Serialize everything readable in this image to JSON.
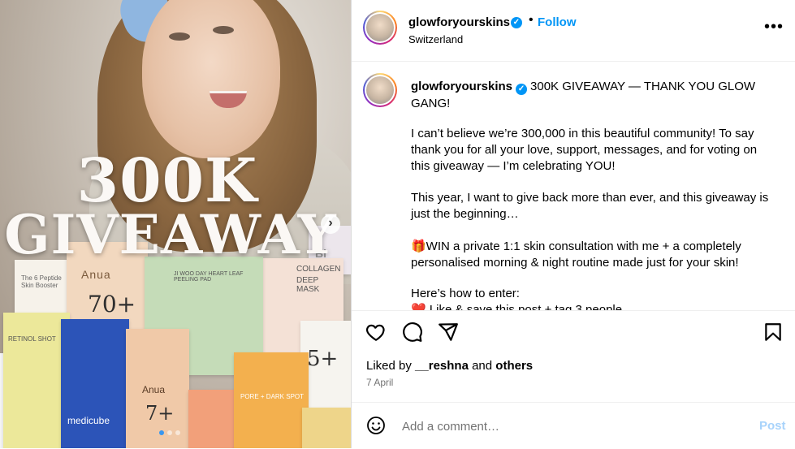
{
  "media": {
    "headline_line1": "300K",
    "headline_line2": "GIVEAWAY",
    "packaging": {
      "anua_big_brand": "Anua",
      "anua_big_number": "70+",
      "peptide_label": "The 6 Peptide Skin Booster",
      "green_box_label": "JI WOO DAY HEART LEAF PEELING PAD",
      "collagen_line1": "COLLAGEN",
      "collagen_line2": "DEEP MASK",
      "collagen_right_label": "Bi",
      "retinol_label": "RETINOL SHOT",
      "medicube_label": "medicube",
      "anua_small_brand": "Anua",
      "anua_small_number": "7+",
      "pore_label": "PORE + DARK SPOT",
      "mint_number": "5+"
    },
    "carousel_dots": 3,
    "active_dot": 0,
    "accent_color": "#3897f0"
  },
  "header": {
    "username": "glowforyourskins",
    "separator": "•",
    "follow_label": "Follow",
    "location": "Switzerland",
    "more_label": "•••"
  },
  "caption": {
    "username": "glowforyourskins",
    "headline": "300K GIVEAWAY — THANK YOU GLOW GANG!",
    "p1": "I can’t believe we’re 300,000 in this beautiful community! To say thank you for all your love, support, messages, and for voting on this giveaway — I’m celebrating YOU!",
    "p2": "This year, I want to give back more than ever, and this giveaway is just the beginning…",
    "p3": "🎁WIN a private 1:1 skin consultation with me + a completely personalised morning & night routine made just for your skin!",
    "p4": "Here’s how to enter:",
    "p5": "❤️ Like & save this post + tag 3 people"
  },
  "actions": {
    "icons": [
      "heart-icon",
      "comment-icon",
      "share-icon",
      "bookmark-icon"
    ]
  },
  "likes": {
    "prefix": "Liked by",
    "user": "__reshna",
    "and": "and",
    "others": "others"
  },
  "date": "7 April",
  "comment": {
    "placeholder": "Add a comment…",
    "post_label": "Post"
  },
  "colors": {
    "link_blue": "#0095f6",
    "post_disabled": "#a8d3fb",
    "muted": "#737373"
  }
}
